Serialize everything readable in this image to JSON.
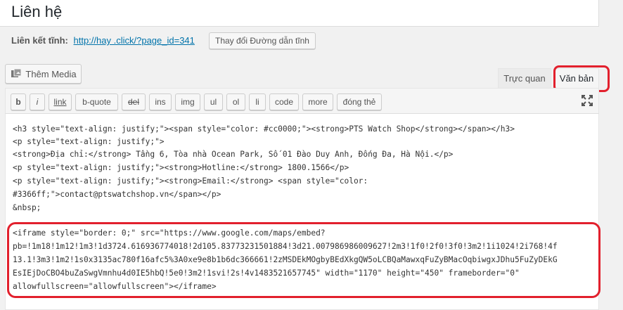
{
  "post_title": "Liên hệ",
  "permalink": {
    "label": "Liên kết tĩnh:",
    "url_text": "http://hay        .click/?page_id=341",
    "change_button": "Thay đổi Đường dẫn tĩnh"
  },
  "media": {
    "add_media_label": "Thêm Media",
    "icon": "media-icon"
  },
  "editor_tabs": {
    "visual": "Trực quan",
    "text": "Văn bản",
    "active": "text"
  },
  "quicktags": [
    "b",
    "i",
    "link",
    "b-quote",
    "del",
    "ins",
    "img",
    "ul",
    "ol",
    "li",
    "code",
    "more",
    "đóng thẻ"
  ],
  "fullscreen_icon": "fullscreen-icon",
  "editor_lines": [
    "<h3 style=\"text-align: justify;\"><span style=\"color: #cc0000;\"><strong>PTS Watch Shop</strong></span></h3>",
    "<p style=\"text-align: justify;\">",
    "<strong>Địa chỉ:</strong> Tầng 6, Tòa nhà Ocean Park, Số 01 Đào Duy Anh, Đống Đa, Hà Nội.</p>",
    "<p style=\"text-align: justify;\"><strong>Hotline:</strong> 1800.1566</p>",
    "<p style=\"text-align: justify;\"><strong>Email:</strong> <span style=\"color:",
    "#3366ff;\">contact@ptswatchshop.vn</span></p>",
    "&nbsp;",
    "<iframe style=\"border: 0;\" src=\"https://www.google.com/maps/embed?",
    "pb=!1m18!1m12!1m3!1d3724.616936774018!2d105.83773231501884!3d21.007986986009627!2m3!1f0!2f0!3f0!3m2!1i1024!2i768!4f",
    "13.1!3m3!1m2!1s0x3135ac780f16afc5%3A0xe9e8b1b6dc366661!2zMSDEkMOgbyBEdXkgQW5oLCBQaMawxqFuZyBMacOqbiwgxJDhu5FuZyDEkG",
    "EsIEjDoCBO4buZaSwgVmnhu4d0IE5hbQ!5e0!3m2!1svi!2s!4v1483521657745\" width=\"1170\" height=\"450\" frameborder=\"0\"",
    "allowfullscreen=\"allowfullscreen\"></iframe>"
  ],
  "highlight_color": "#e2202d"
}
